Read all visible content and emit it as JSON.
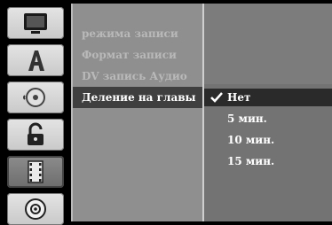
{
  "sidebar": {
    "icons": [
      {
        "name": "tv-screen-icon"
      },
      {
        "name": "language-a-icon"
      },
      {
        "name": "audio-disc-icon"
      },
      {
        "name": "lock-icon"
      },
      {
        "name": "film-strip-icon"
      },
      {
        "name": "disc-icon"
      }
    ],
    "active_index": 4
  },
  "menu": {
    "items": [
      {
        "label": "режима записи"
      },
      {
        "label": "Формат записи"
      },
      {
        "label": "DV запись Аудио"
      },
      {
        "label": "Деление на главы"
      }
    ],
    "active_index": 3
  },
  "options": {
    "items": [
      {
        "label": "Нет",
        "checked": true
      },
      {
        "label": "5 мин."
      },
      {
        "label": "10 мин."
      },
      {
        "label": "15 мин."
      }
    ]
  },
  "colors": {
    "background": "#000000",
    "menu_panel": "#8f8f8f",
    "options_panel": "#737373",
    "active_row": "#3f3f3f"
  }
}
